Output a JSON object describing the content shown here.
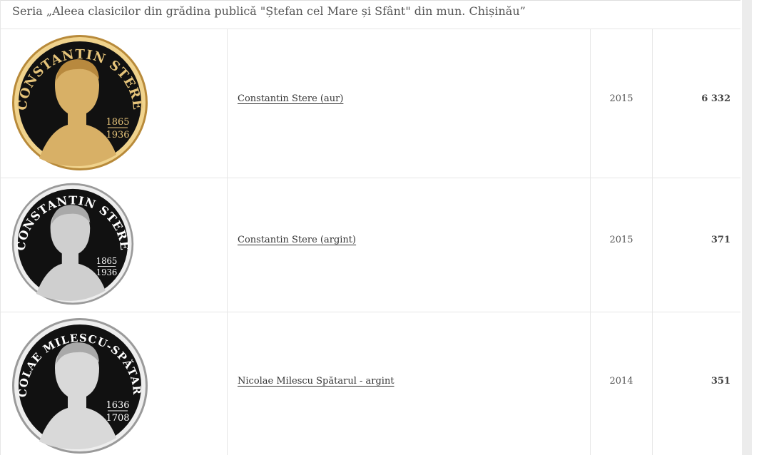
{
  "title": "Seria „Aleea clasicilor din grădina publică \"Ștefan cel Mare și Sfânt\" din mun. Chișinău”",
  "rows": [
    {
      "name": "Constantin Stere (aur)",
      "year": "2015",
      "count": "6 332",
      "coin": {
        "legend": "CONSTANTIN STERE",
        "years": [
          "1865",
          "1936"
        ],
        "metal": "gold",
        "face": "#d8b066",
        "legend_color": "#e6c47a"
      }
    },
    {
      "name": "Constantin Stere (argint)",
      "year": "2015",
      "count": "371",
      "coin": {
        "legend": "CONSTANTIN STERE",
        "years": [
          "1865",
          "1936"
        ],
        "metal": "silver",
        "face": "#cfcfcf",
        "legend_color": "#ffffff"
      }
    },
    {
      "name": "Nicolae Milescu Spătarul - argint",
      "year": "2014",
      "count": "351",
      "coin": {
        "legend": "NICOLAE MILESCU-SPĂTARUL",
        "years": [
          "1636",
          "1708"
        ],
        "metal": "silver",
        "face": "#d9d9d9",
        "legend_color": "#ffffff"
      }
    }
  ]
}
